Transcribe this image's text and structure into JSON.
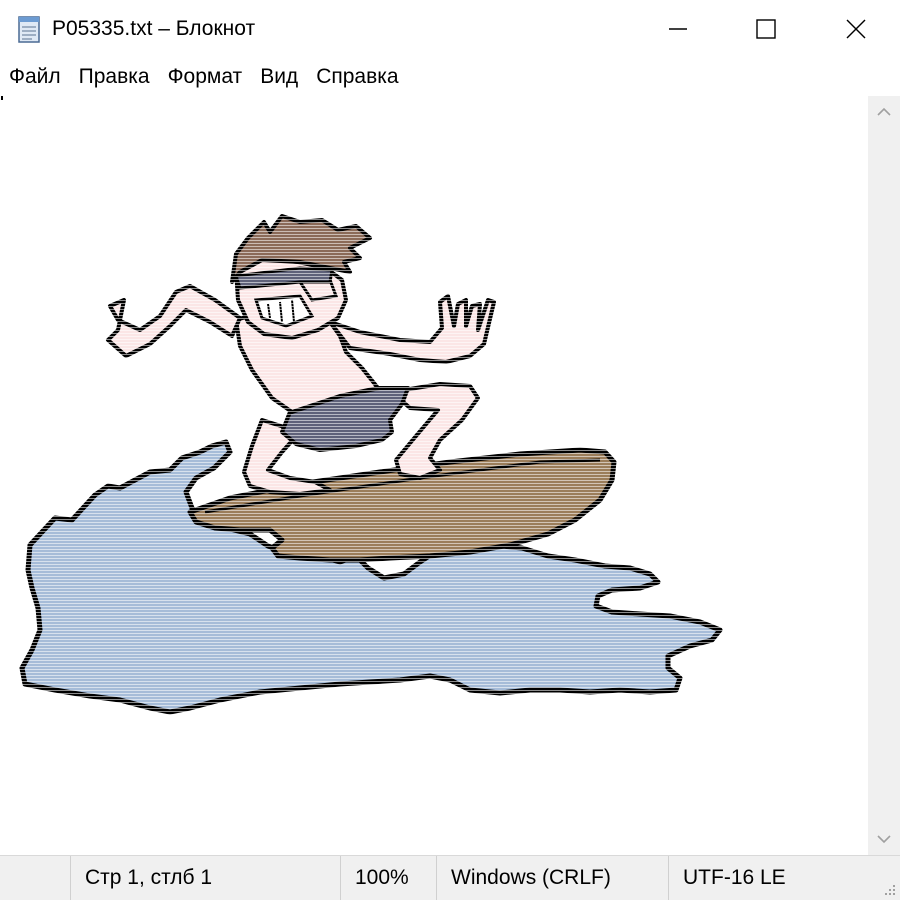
{
  "window": {
    "title": "P05335.txt – Блокнот",
    "icon": "notepad-icon"
  },
  "menu": {
    "items": [
      {
        "label": "Файл"
      },
      {
        "label": "Правка"
      },
      {
        "label": "Формат"
      },
      {
        "label": "Вид"
      },
      {
        "label": "Справка"
      }
    ]
  },
  "content": {
    "image": "surfer-cartoon-ascii-art",
    "colors": {
      "water": "#a6bcd8",
      "board": "#9b7d5a",
      "hair": "#8b6a58",
      "skin": "#fbe6e6",
      "shorts": "#5e6179",
      "outline": "#000000"
    }
  },
  "statusbar": {
    "position": "Стр 1, стлб 1",
    "zoom": "100%",
    "line_endings": "Windows (CRLF)",
    "encoding": "UTF-16 LE"
  }
}
